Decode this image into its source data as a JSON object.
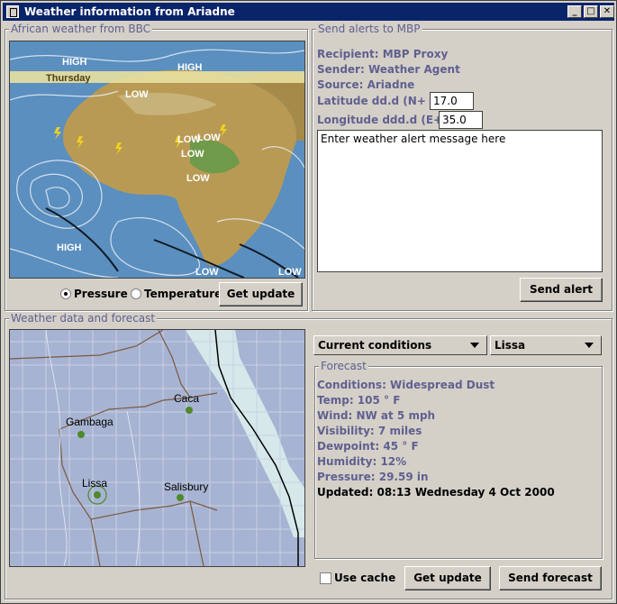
{
  "window": {
    "title": "Weather information from Ariadne"
  },
  "bbc": {
    "group_title": "African weather from BBC",
    "map_labels": [
      "HIGH",
      "HIGH",
      "Thursday",
      "LOW",
      "LOW",
      "LOW",
      "LOW",
      "LOW",
      "HIGH",
      "LOW",
      "LOW"
    ],
    "radio_pressure": "Pressure",
    "radio_temperature": "Temperature",
    "selected": "Pressure",
    "update_button": "Get update"
  },
  "alerts": {
    "group_title": "Send alerts to MBP",
    "recipient": "Recipient: MBP Proxy",
    "sender": "Sender: Weather Agent",
    "source": "Source: Ariadne",
    "lat_label": "Latitude dd.d (N+ S-)",
    "lat_value": "17.0",
    "lon_label": "Longitude ddd.d (E+ W-)",
    "lon_value": "35.0",
    "message": "Enter weather alert message here",
    "send_button": "Send alert"
  },
  "forecast_panel": {
    "group_title": "Weather data and forecast",
    "mode_select": "Current conditions",
    "location_select": "Lissa",
    "map_places": [
      "Caca",
      "Gambaga",
      "Lissa",
      "Salisbury"
    ],
    "sub_title": "Forecast",
    "conditions": "Conditions: Widespread Dust",
    "temp": "Temp: 105 ° F",
    "wind": "Wind: NW  at  5  mph",
    "visibility": "Visibility: 7  miles",
    "dewpoint": "Dewpoint: 45 ° F",
    "humidity": "Humidity: 12%",
    "pressure": "Pressure: 29.59  in",
    "updated": "Updated: 08:13 Wednesday 4 Oct 2000",
    "use_cache": "Use cache",
    "use_cache_checked": false,
    "get_update": "Get update",
    "send_forecast": "Send forecast"
  }
}
